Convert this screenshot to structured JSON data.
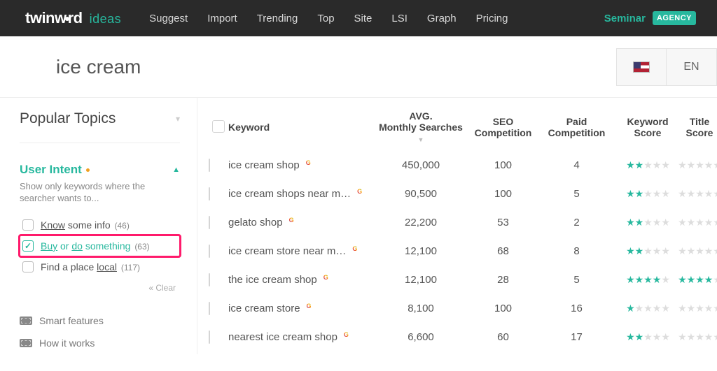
{
  "nav": {
    "logo_a": "twinw",
    "logo_b": "rd",
    "logo_ideas": "ideas",
    "links": [
      "Suggest",
      "Import",
      "Trending",
      "Top",
      "Site",
      "LSI",
      "Graph",
      "Pricing"
    ],
    "seminar": "Seminar",
    "agency": "AGENCY"
  },
  "search": {
    "term": "ice cream",
    "lang": "EN"
  },
  "sidebar": {
    "popular_title": "Popular Topics",
    "intent_title": "User Intent",
    "intent_sub": "Show only keywords where the searcher wants to...",
    "options": [
      {
        "pre": "Know",
        "rest": " some info",
        "count": "(46)",
        "checked": false,
        "hl": false
      },
      {
        "pre": "Buy",
        "mid": " or ",
        "pre2": "do",
        "rest": " something",
        "count": "(63)",
        "checked": true,
        "hl": true
      },
      {
        "rest_a": "Find a place ",
        "pre": "local",
        "count": "(117)",
        "checked": false,
        "hl": false
      }
    ],
    "clear": "« Clear",
    "help": [
      "Smart features",
      "How it works"
    ]
  },
  "table": {
    "headers": {
      "keyword": "Keyword",
      "avg_a": "AVG.",
      "avg_b": "Monthly Searches",
      "seo": "SEO Competition",
      "paid": "Paid Competition",
      "kscore": "Keyword Score",
      "tscore": "Title Score"
    },
    "rows": [
      {
        "kw": "ice cream shop",
        "avg": "450,000",
        "seo": "100",
        "paid": "4",
        "ks": 2,
        "ts": 0
      },
      {
        "kw": "ice cream shops near m…",
        "avg": "90,500",
        "seo": "100",
        "paid": "5",
        "ks": 2,
        "ts": 0
      },
      {
        "kw": "gelato shop",
        "avg": "22,200",
        "seo": "53",
        "paid": "2",
        "ks": 2,
        "ts": 0
      },
      {
        "kw": "ice cream store near m…",
        "avg": "12,100",
        "seo": "68",
        "paid": "8",
        "ks": 2,
        "ts": 0
      },
      {
        "kw": "the ice cream shop",
        "avg": "12,100",
        "seo": "28",
        "paid": "5",
        "ks": 4,
        "ts": 4
      },
      {
        "kw": "ice cream store",
        "avg": "8,100",
        "seo": "100",
        "paid": "16",
        "ks": 1,
        "ts": 0
      },
      {
        "kw": "nearest ice cream shop",
        "avg": "6,600",
        "seo": "60",
        "paid": "17",
        "ks": 2,
        "ts": 0
      }
    ]
  }
}
